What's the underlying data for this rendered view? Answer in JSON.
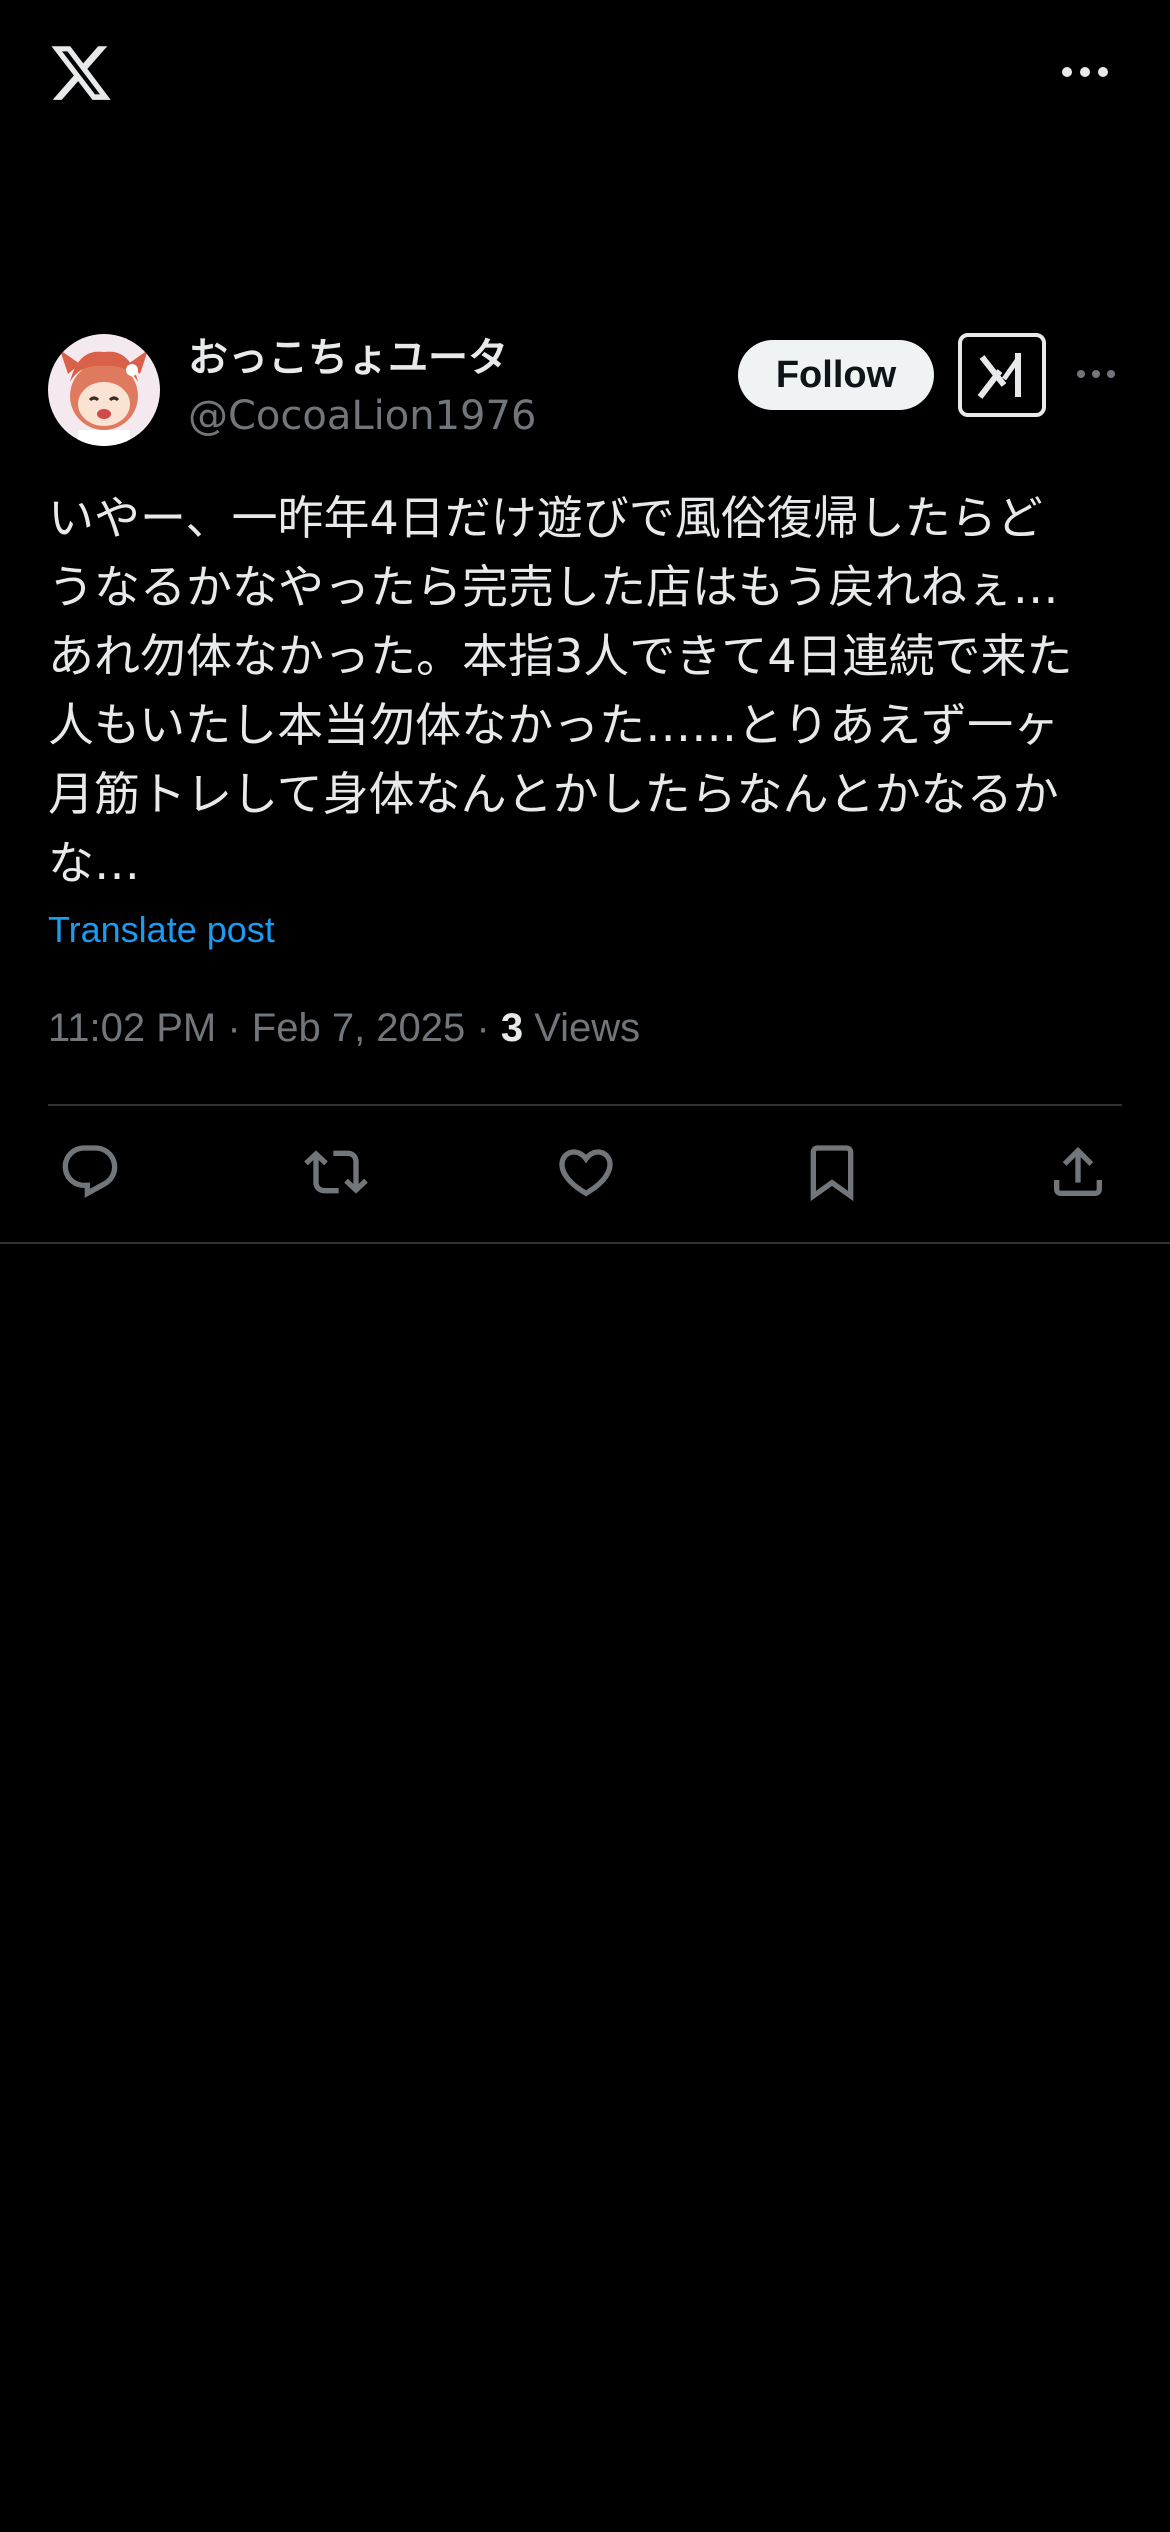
{
  "top_bar": {
    "logo_icon": "x-logo-icon",
    "more_icon": "more-horizontal-icon"
  },
  "author": {
    "display_name": "おっこちょユータ",
    "handle": "@CocoaLion1976",
    "avatar_icon": "avatar-anime-character"
  },
  "actions_header": {
    "follow_label": "Follow",
    "grok_icon": "grok-icon",
    "more_icon": "more-horizontal-icon"
  },
  "tweet": {
    "text": "いやー、一昨年4日だけ遊びで風俗復帰したらど\nうなるかなやったら完売した店はもう戻れねぇ…\nあれ勿体なかった。本指3人できて4日連続で来た\n人もいたし本当勿体なかった……とりあえず一ヶ\n月筋トレして身体なんとかしたらなんとかなるか\nな…",
    "translate_label": "Translate post",
    "time": "11:02 PM",
    "separator": " · ",
    "date": "Feb 7, 2025",
    "views_count": "3",
    "views_label": " Views"
  },
  "action_bar": {
    "items": [
      {
        "icon": "reply-icon"
      },
      {
        "icon": "retweet-icon"
      },
      {
        "icon": "like-icon"
      },
      {
        "icon": "bookmark-icon"
      },
      {
        "icon": "share-icon"
      }
    ]
  },
  "colors": {
    "background": "#000000",
    "text_primary": "#e7e9ea",
    "text_secondary": "#71767b",
    "link": "#1d9bf0",
    "divider": "#2f3336"
  }
}
